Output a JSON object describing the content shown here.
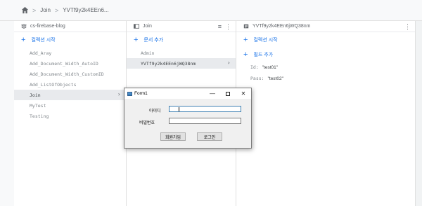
{
  "breadcrumb": {
    "items": [
      "Join",
      "YVTf9y2k4EEn6..."
    ]
  },
  "columns": {
    "collections": {
      "header": "cs-firebase-blog",
      "add_label": "컬렉션 시작",
      "items": [
        {
          "label": "Add_Aray"
        },
        {
          "label": "Add_Document_Width_AutoID"
        },
        {
          "label": "Add_Document_Width_CustomID"
        },
        {
          "label": "Add_ListOfObjects"
        },
        {
          "label": "Join",
          "selected": true
        },
        {
          "label": "MyTest"
        },
        {
          "label": "Testing"
        }
      ]
    },
    "documents": {
      "header": "Join",
      "add_label": "문서 추가",
      "items": [
        {
          "label": "Admin"
        },
        {
          "label": "YVTf9y2k4EEn6jWQ38nm",
          "selected": true
        }
      ]
    },
    "detail": {
      "header": "YVTf9y2k4EEn6jWQ38nm",
      "add_collection_label": "컬렉션 시작",
      "add_field_label": "필드 추가",
      "fields": [
        {
          "key": "Id:",
          "value": "\"test01\""
        },
        {
          "key": "Pass:",
          "value": "\"test02\""
        }
      ]
    }
  },
  "dialog": {
    "title": "Form1",
    "id_label": "아이디",
    "password_label": "비밀번호",
    "id_value": "",
    "password_value": "",
    "signup_button": "회원가입",
    "login_button": "로그인",
    "close_glyph": "✕",
    "min_glyph": "—"
  },
  "colors": {
    "accent": "#1a73e8",
    "selected_row": "#e8eaed"
  }
}
